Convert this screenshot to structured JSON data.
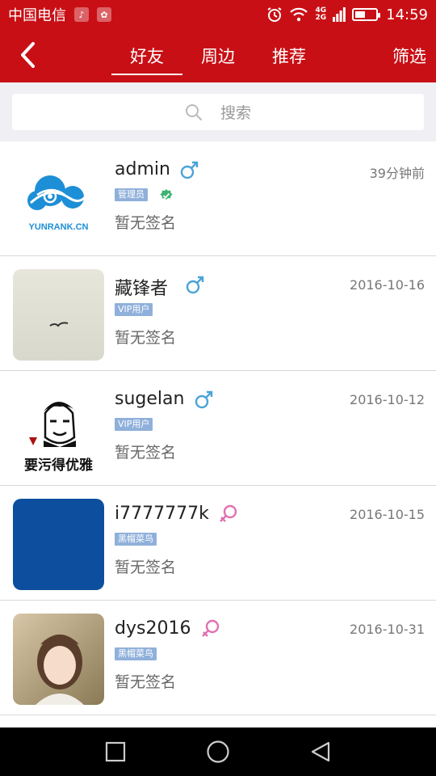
{
  "status_bar": {
    "carrier": "中国电信",
    "net_top": "4G",
    "net_bottom": "2G",
    "battery_level": 0.5,
    "time": "14:59"
  },
  "header": {
    "back_icon": "chevron-left-icon",
    "tabs": [
      {
        "label": "好友",
        "active": true
      },
      {
        "label": "周边",
        "active": false
      },
      {
        "label": "推荐",
        "active": false
      }
    ],
    "filter_label": "筛选"
  },
  "search": {
    "placeholder": "搜索",
    "icon": "search-icon"
  },
  "users": [
    {
      "name": "admin",
      "gender": "male",
      "time": "39分钟前",
      "badge": "管理员",
      "verified": true,
      "signature": "暂无签名",
      "avatar_text": "YUNRANK.CN"
    },
    {
      "name": "藏锋者",
      "gender": "male",
      "time": "2016-10-16",
      "badge": "VIP用户",
      "verified": false,
      "signature": "暂无签名"
    },
    {
      "name": "sugelan",
      "gender": "male",
      "time": "2016-10-12",
      "badge": "VIP用户",
      "verified": false,
      "signature": "暂无签名",
      "avatar_text": "要污得优雅"
    },
    {
      "name": "i7777777k",
      "gender": "female",
      "time": "2016-10-15",
      "badge": "黑帽菜鸟",
      "verified": false,
      "signature": "暂无签名"
    },
    {
      "name": "dys2016",
      "gender": "female",
      "time": "2016-10-31",
      "badge": "黑帽菜鸟",
      "verified": false,
      "signature": "暂无签名"
    }
  ],
  "colors": {
    "brand_red": "#c80f15",
    "male": "#4aa3d8",
    "female": "#e26fb0",
    "badge": "#8fb0da",
    "verified": "#3cb371"
  },
  "nav_bar": {
    "icons": [
      "recent-apps-icon",
      "home-icon",
      "back-icon"
    ]
  }
}
